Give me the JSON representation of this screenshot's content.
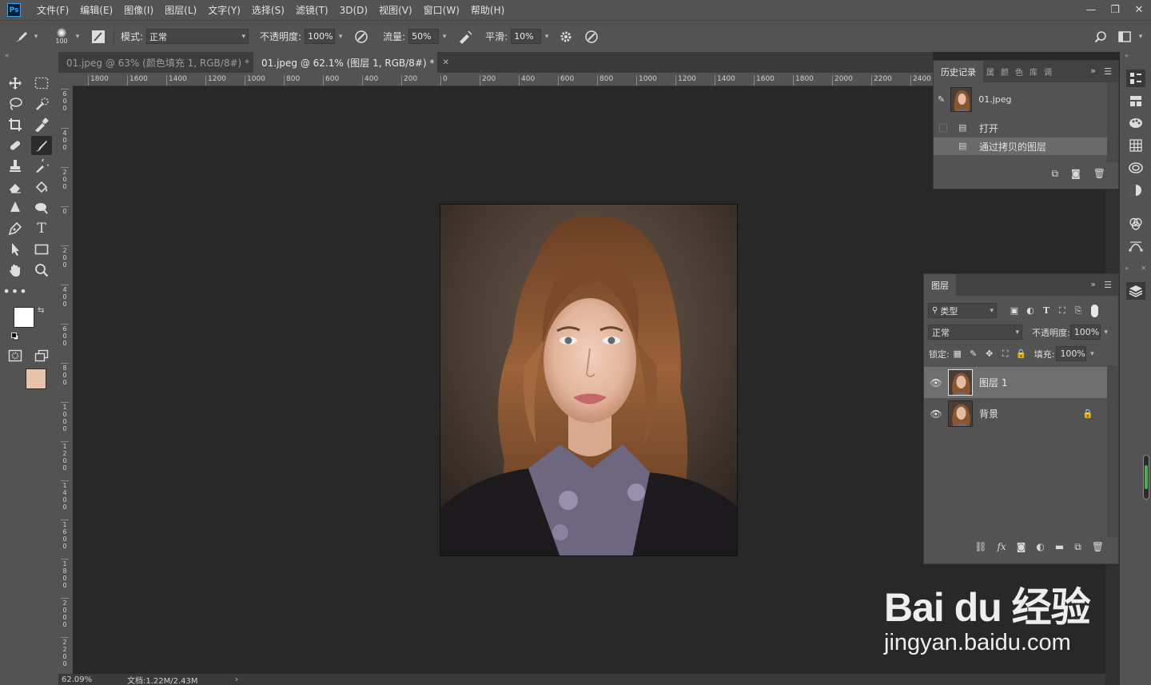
{
  "app": {
    "logo": "Ps"
  },
  "menu": [
    "文件(F)",
    "编辑(E)",
    "图像(I)",
    "图层(L)",
    "文字(Y)",
    "选择(S)",
    "滤镜(T)",
    "3D(D)",
    "视图(V)",
    "窗口(W)",
    "帮助(H)"
  ],
  "window_controls": {
    "minimize": "—",
    "restore": "❐",
    "close": "✕"
  },
  "options": {
    "brush_size": "100",
    "mode_label": "模式:",
    "mode_value": "正常",
    "opacity_label": "不透明度:",
    "opacity_value": "100%",
    "flow_label": "流量:",
    "flow_value": "50%",
    "smoothing_label": "平滑:",
    "smoothing_value": "10%"
  },
  "tabs": [
    {
      "label": "01.jpeg @ 63% (颜色填充 1, RGB/8#) *",
      "active": false
    },
    {
      "label": "01.jpeg @ 62.1% (图层 1, RGB/8#) *",
      "active": true
    }
  ],
  "tab_close": "✕",
  "ruler_h": [
    "1800",
    "1600",
    "1400",
    "1200",
    "1000",
    "800",
    "600",
    "400",
    "200",
    "0",
    "200",
    "400",
    "600",
    "800",
    "1000",
    "1200",
    "1400",
    "1600",
    "1800",
    "2000",
    "2200",
    "2400"
  ],
  "ruler_v": [
    "600",
    "400",
    "200",
    "0",
    "200",
    "400",
    "600",
    "800",
    "1000",
    "1200",
    "1400",
    "1600",
    "1800",
    "2000",
    "2200"
  ],
  "colors": {
    "foreground": "#ffffff",
    "background": "#e8c4ac",
    "accent": "#31a8ff"
  },
  "status": {
    "zoom": "62.09%",
    "doc": "文档:1.22M/2.43M",
    "arrow": "›"
  },
  "history": {
    "tabs": [
      "历史记录",
      "属",
      "颜",
      "色",
      "库",
      "调"
    ],
    "snapshot_name": "01.jpeg",
    "items": [
      {
        "label": "打开",
        "selected": false
      },
      {
        "label": "通过拷贝的图层",
        "selected": true
      }
    ]
  },
  "layers": {
    "tab": "图层",
    "filter_value": "类型",
    "blend_value": "正常",
    "opacity_label": "不透明度:",
    "opacity_value": "100%",
    "lock_label": "锁定:",
    "fill_label": "填充:",
    "fill_value": "100%",
    "items": [
      {
        "name": "图层 1",
        "selected": true,
        "locked": false
      },
      {
        "name": "背景",
        "selected": false,
        "locked": true
      }
    ]
  },
  "watermark": {
    "logo": "Bai du 经验",
    "url": "jingyan.baidu.com"
  }
}
